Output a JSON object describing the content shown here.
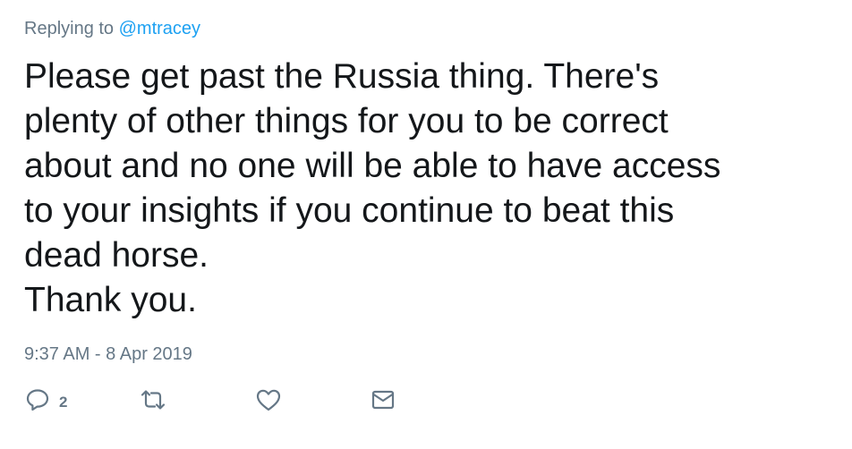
{
  "tweet": {
    "reply_prefix": "Replying to ",
    "reply_handle": "@mtracey",
    "text_lines": [
      "Please get past the Russia thing. There's",
      "plenty of other things for you to be correct",
      "about and no one will be able to have access",
      "to your insights if you continue to beat this",
      "dead horse.",
      "Thank you."
    ],
    "timestamp": "9:37 AM - 8 Apr 2019"
  },
  "actions": {
    "reply": {
      "icon": "reply-bubble-icon",
      "count": "2"
    },
    "retweet": {
      "icon": "retweet-icon"
    },
    "like": {
      "icon": "heart-icon"
    },
    "message": {
      "icon": "envelope-icon"
    }
  },
  "colors": {
    "text": "#14171a",
    "secondary": "#657786",
    "link": "#1da1f2",
    "background": "#ffffff"
  }
}
